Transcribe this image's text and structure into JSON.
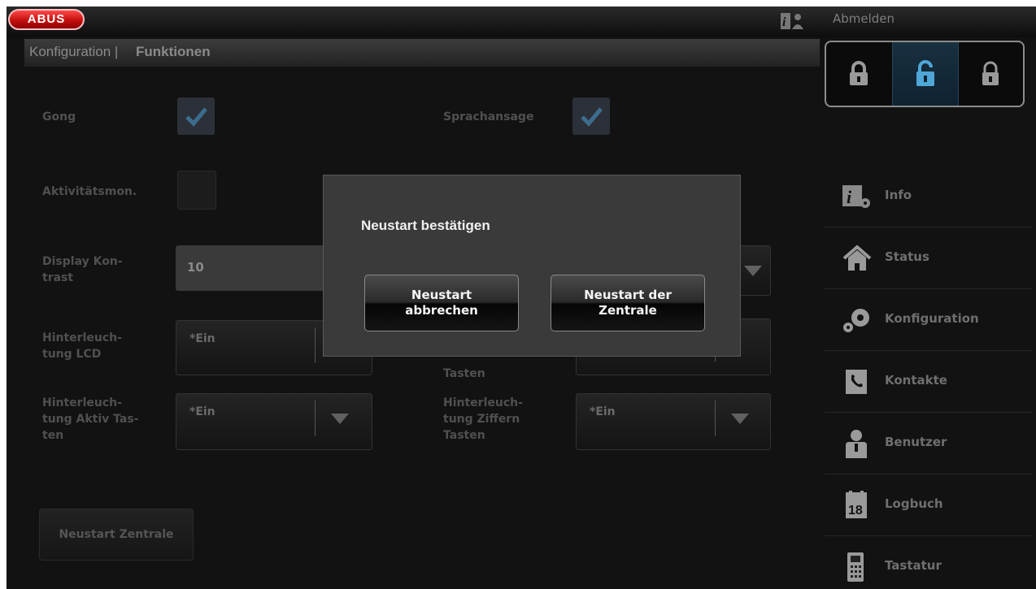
{
  "header": {
    "logo_text": "ABUS",
    "logout_label": "Abmelden",
    "breadcrumb_section": "Konfiguration |",
    "breadcrumb_page": "Funktionen"
  },
  "lock_panel": {
    "items": [
      {
        "name": "lock-closed-icon",
        "active": false
      },
      {
        "name": "lock-partial-icon",
        "active": true
      },
      {
        "name": "lock-open-icon",
        "active": false
      }
    ]
  },
  "sidebar": {
    "items": [
      {
        "label": "Info",
        "icon": "info-icon"
      },
      {
        "label": "Status",
        "icon": "home-icon"
      },
      {
        "label": "Konfiguration",
        "icon": "gears-icon"
      },
      {
        "label": "Kontakte",
        "icon": "phone-book-icon"
      },
      {
        "label": "Benutzer",
        "icon": "user-icon"
      },
      {
        "label": "Logbuch",
        "icon": "calendar-icon"
      },
      {
        "label": "Tastatur",
        "icon": "keypad-icon"
      }
    ]
  },
  "form": {
    "gong_label": "Gong",
    "gong_checked": true,
    "speech_label": "Sprachansage",
    "speech_checked": true,
    "activity_label": "Aktivitätsmon.",
    "activity_checked": false,
    "contrast_label_1": "Display Kon-",
    "contrast_label_2": "trast",
    "contrast_value": "10",
    "lcd_label_1": "Hinterleuch-",
    "lcd_label_2": "tung LCD",
    "lcd_value": "*Ein",
    "right_mid_label": "Tasten",
    "active_keys_label_1": "Hinterleuch-",
    "active_keys_label_2": "tung Aktiv Tas-",
    "active_keys_label_3": "ten",
    "active_keys_value": "*Ein",
    "digit_keys_label_1": "Hinterleuch-",
    "digit_keys_label_2": "tung Ziffern",
    "digit_keys_label_3": "Tasten",
    "digit_keys_value": "*Ein",
    "restart_button": "Neustart Zentrale"
  },
  "dialog": {
    "title": "Neustart bestätigen",
    "cancel_line1": "Neustart",
    "cancel_line2": "abbrechen",
    "confirm_line1": "Neustart der",
    "confirm_line2": "Zentrale"
  },
  "colors": {
    "brand_red": "#d01010",
    "lock_active": "#4fa7d8"
  }
}
